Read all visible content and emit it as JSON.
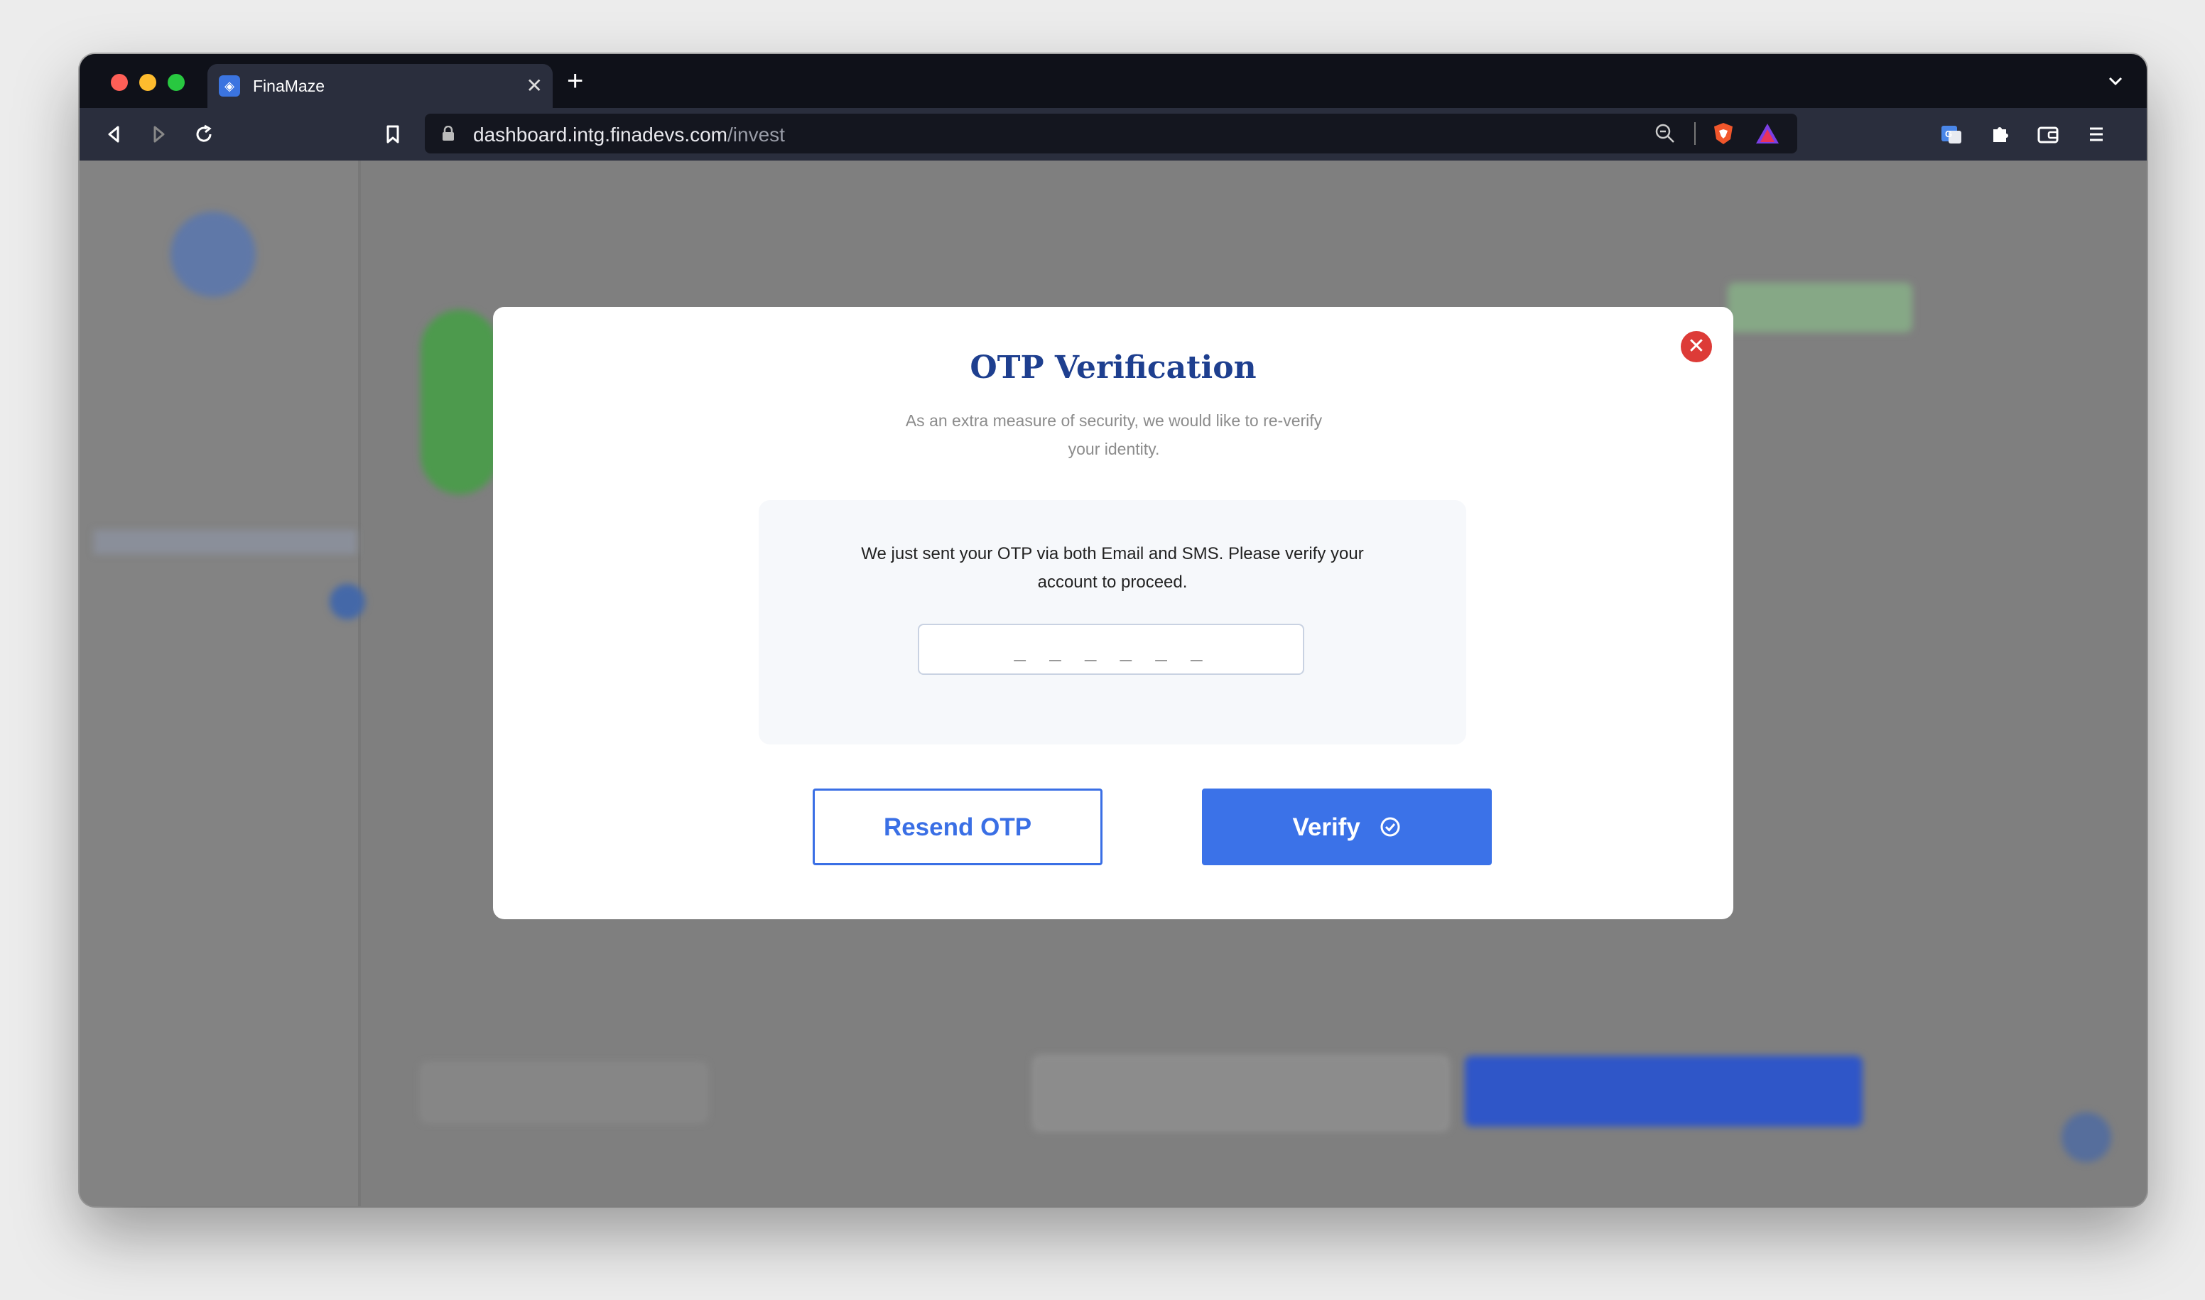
{
  "browser": {
    "tab_title": "FinaMaze",
    "url_host": "dashboard.intg.finadevs.com",
    "url_path": "/invest"
  },
  "modal": {
    "title": "OTP Verification",
    "subtitle": "As an extra measure of security, we would like to re-verify your identity.",
    "info_text": "We just sent your OTP via both Email and SMS. Please verify your account to proceed.",
    "otp_placeholder": "_ _ _ _ _ _",
    "otp_value": "",
    "resend_label": "Resend OTP",
    "verify_label": "Verify"
  },
  "colors": {
    "primary": "#3b72e8",
    "title": "#1e3f8f",
    "close": "#dd3b37"
  }
}
